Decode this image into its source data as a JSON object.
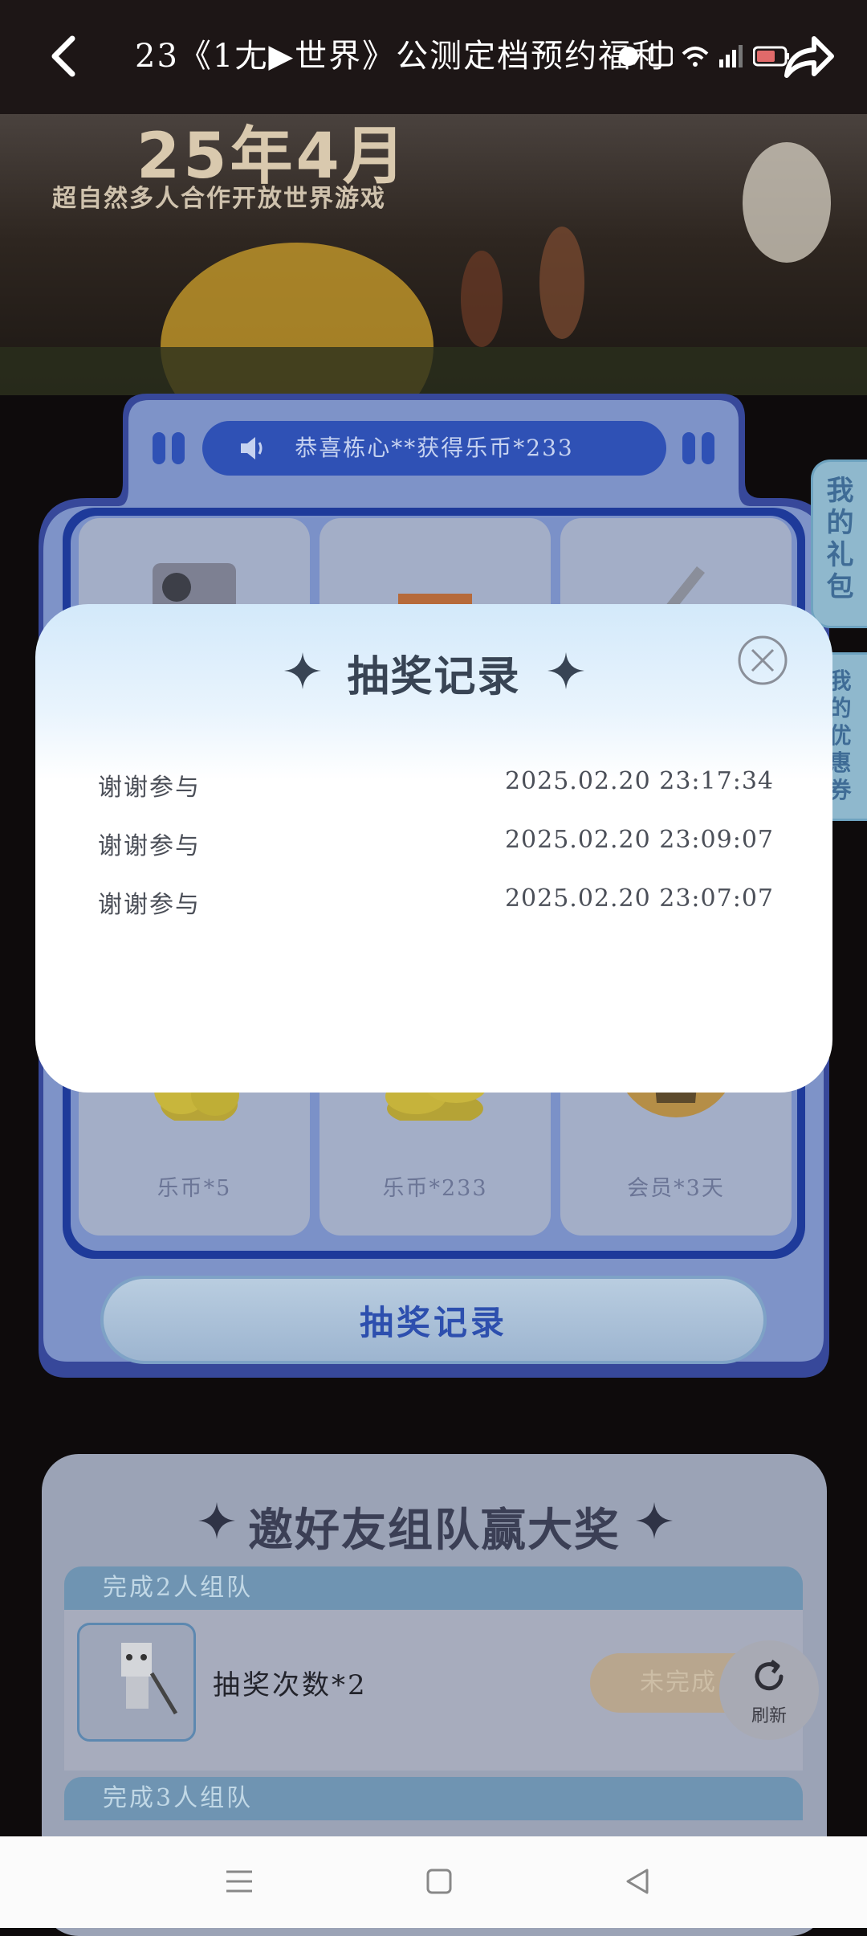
{
  "header": {
    "title": "23《1尢▶世界》公测定档预约福利",
    "status_icons": [
      "alarm-icon",
      "hd-icon",
      "wifi-icon",
      "5g-signal-icon",
      "battery-icon"
    ]
  },
  "banner": {
    "date_text": "25年4月",
    "subtitle": "超自然多人合作开放世界游戏"
  },
  "lottery": {
    "marquee_text": "恭喜栋心**获得乐币*233",
    "prizes_bottom": [
      {
        "label": "乐币*5"
      },
      {
        "label": "乐币*233"
      },
      {
        "label": "会员*3天"
      }
    ],
    "draw_record_button": "抽奖记录"
  },
  "side_tabs": {
    "gift_bag": "我的礼包",
    "coupons": "我的优惠券"
  },
  "team": {
    "title": "邀好友组队赢大奖",
    "tier1_heading": "完成2人组队",
    "tier1_reward": "抽奖次数*2",
    "tier1_status": "未完成",
    "tier2_heading": "完成3人组队",
    "refresh_label": "刷新"
  },
  "modal": {
    "title": "抽奖记录",
    "records": [
      {
        "name": "谢谢参与",
        "time": "2025.02.20 23:17:34"
      },
      {
        "name": "谢谢参与",
        "time": "2025.02.20 23:09:07"
      },
      {
        "name": "谢谢参与",
        "time": "2025.02.20 23:07:07"
      }
    ]
  },
  "colors": {
    "panel_blue": "#2f51b5",
    "modal_header": "#d3e9fa",
    "side_tab": "#8fb8cd"
  }
}
